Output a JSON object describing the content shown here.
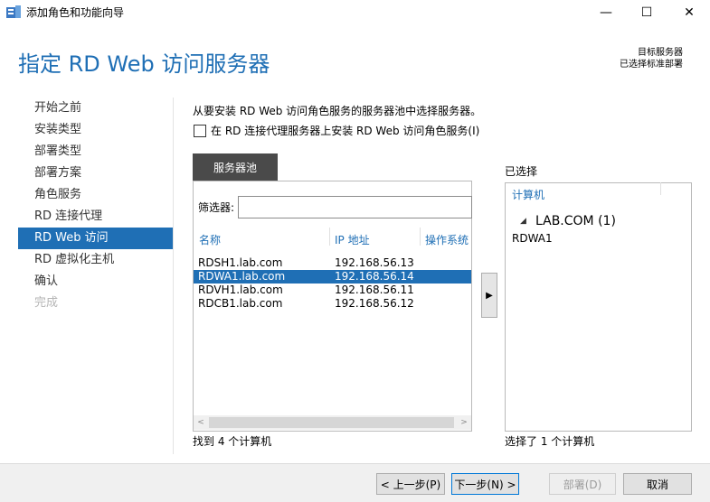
{
  "window": {
    "title": "添加角色和功能向导",
    "minimize_glyph": "—",
    "maximize_glyph": "☐",
    "close_glyph": "✕"
  },
  "header": {
    "title": "指定 RD Web 访问服务器",
    "destination_label": "目标服务器",
    "destination_value": "已选择标准部署"
  },
  "nav": {
    "items": [
      {
        "label": "开始之前",
        "state": "normal"
      },
      {
        "label": "安装类型",
        "state": "normal"
      },
      {
        "label": "部署类型",
        "state": "normal"
      },
      {
        "label": "部署方案",
        "state": "normal"
      },
      {
        "label": "角色服务",
        "state": "normal"
      },
      {
        "label": "RD 连接代理",
        "state": "normal"
      },
      {
        "label": "RD Web 访问",
        "state": "active"
      },
      {
        "label": "RD 虚拟化主机",
        "state": "normal"
      },
      {
        "label": "确认",
        "state": "normal"
      },
      {
        "label": "完成",
        "state": "disabled"
      }
    ]
  },
  "content": {
    "instruction": "从要安装 RD Web 访问角色服务的服务器池中选择服务器。",
    "checkbox_label": "在 RD 连接代理服务器上安装 RD Web 访问角色服务(I)",
    "checkbox_checked": false
  },
  "pool": {
    "tab_label": "服务器池",
    "filter_label": "筛选器:",
    "filter_value": "",
    "columns": [
      "名称",
      "IP 地址",
      "操作系统"
    ],
    "rows": [
      {
        "name": "RDSH1.lab.com",
        "ip": "192.168.56.13",
        "selected": false
      },
      {
        "name": "RDWA1.lab.com",
        "ip": "192.168.56.14",
        "selected": true
      },
      {
        "name": "RDVH1.lab.com",
        "ip": "192.168.56.11",
        "selected": false
      },
      {
        "name": "RDCB1.lab.com",
        "ip": "192.168.56.12",
        "selected": false
      }
    ],
    "found_text": "找到 4 个计算机"
  },
  "selected": {
    "title": "已选择",
    "column": "计算机",
    "group_label": "LAB.COM (1)",
    "items": [
      "RDWA1"
    ],
    "count_text": "选择了 1 个计算机"
  },
  "footer": {
    "prev_label": "< 上一步(P)",
    "next_label": "下一步(N) >",
    "deploy_label": "部署(D)",
    "cancel_label": "取消"
  },
  "colors": {
    "accent": "#1f6fb5",
    "tab_dark": "#4a4a4a"
  }
}
